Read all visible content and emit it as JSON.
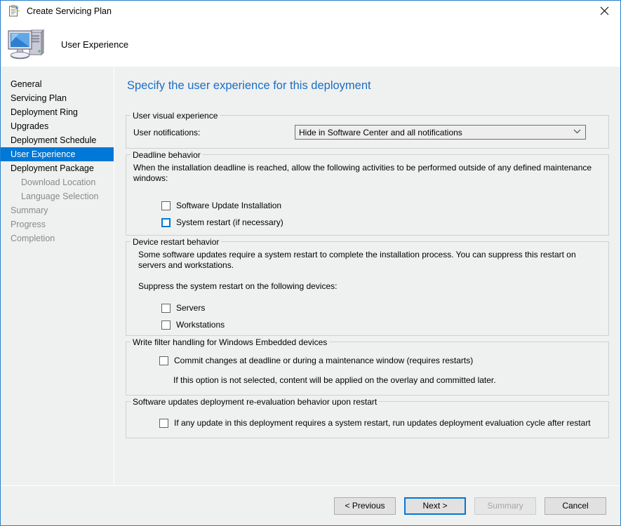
{
  "window": {
    "title": "Create Servicing Plan",
    "title_icon": "servicing-plan-icon",
    "close_label": "✕",
    "banner_title": "User Experience",
    "banner_icon": "computer-icon"
  },
  "sidebar": {
    "items": [
      {
        "label": "General",
        "state": "normal",
        "level": 0
      },
      {
        "label": "Servicing Plan",
        "state": "normal",
        "level": 0
      },
      {
        "label": "Deployment Ring",
        "state": "normal",
        "level": 0
      },
      {
        "label": "Upgrades",
        "state": "normal",
        "level": 0
      },
      {
        "label": "Deployment Schedule",
        "state": "normal",
        "level": 0
      },
      {
        "label": "User Experience",
        "state": "selected",
        "level": 0
      },
      {
        "label": "Deployment Package",
        "state": "normal",
        "level": 0
      },
      {
        "label": "Download Location",
        "state": "disabled",
        "level": 1
      },
      {
        "label": "Language Selection",
        "state": "disabled",
        "level": 1
      },
      {
        "label": "Summary",
        "state": "disabled",
        "level": 0
      },
      {
        "label": "Progress",
        "state": "disabled",
        "level": 0
      },
      {
        "label": "Completion",
        "state": "disabled",
        "level": 0
      }
    ]
  },
  "main": {
    "heading": "Specify the user experience for this deployment",
    "visual_experience": {
      "legend": "User visual experience",
      "notifications_label": "User notifications:",
      "notifications_value": "Hide in Software Center and all notifications",
      "dropdown_arrow": "⌄"
    },
    "deadline_behavior": {
      "legend": "Deadline behavior",
      "description": "When the installation deadline is reached, allow the following activities to be performed outside of any defined maintenance windows:",
      "checkboxes": [
        {
          "label": "Software Update Installation",
          "checked": false,
          "focused": false
        },
        {
          "label": "System restart (if necessary)",
          "checked": false,
          "focused": true
        }
      ]
    },
    "device_restart_behavior": {
      "legend": "Device restart behavior",
      "description": "Some software updates require a system restart to complete the installation process. You can suppress this restart on servers and workstations.",
      "subheading": "Suppress the system restart on the following devices:",
      "checkboxes": [
        {
          "label": "Servers",
          "checked": false,
          "focused": false
        },
        {
          "label": "Workstations",
          "checked": false,
          "focused": false
        }
      ]
    },
    "write_filter": {
      "legend": "Write filter handling for Windows Embedded devices",
      "checkbox_label": "Commit changes at deadline or during a maintenance window (requires restarts)",
      "checked": false,
      "note": "If this option is not selected, content will be applied on the overlay and committed later."
    },
    "reevaluation": {
      "legend": "Software updates deployment re-evaluation behavior upon restart",
      "checkbox_label": "If any update in this deployment requires a system restart, run updates deployment evaluation cycle after restart",
      "checked": false
    }
  },
  "footer": {
    "buttons": [
      {
        "label": "< Previous",
        "state": "normal"
      },
      {
        "label": "Next >",
        "state": "default"
      },
      {
        "label": "Summary",
        "state": "disabled"
      },
      {
        "label": "Cancel",
        "state": "normal"
      }
    ]
  }
}
